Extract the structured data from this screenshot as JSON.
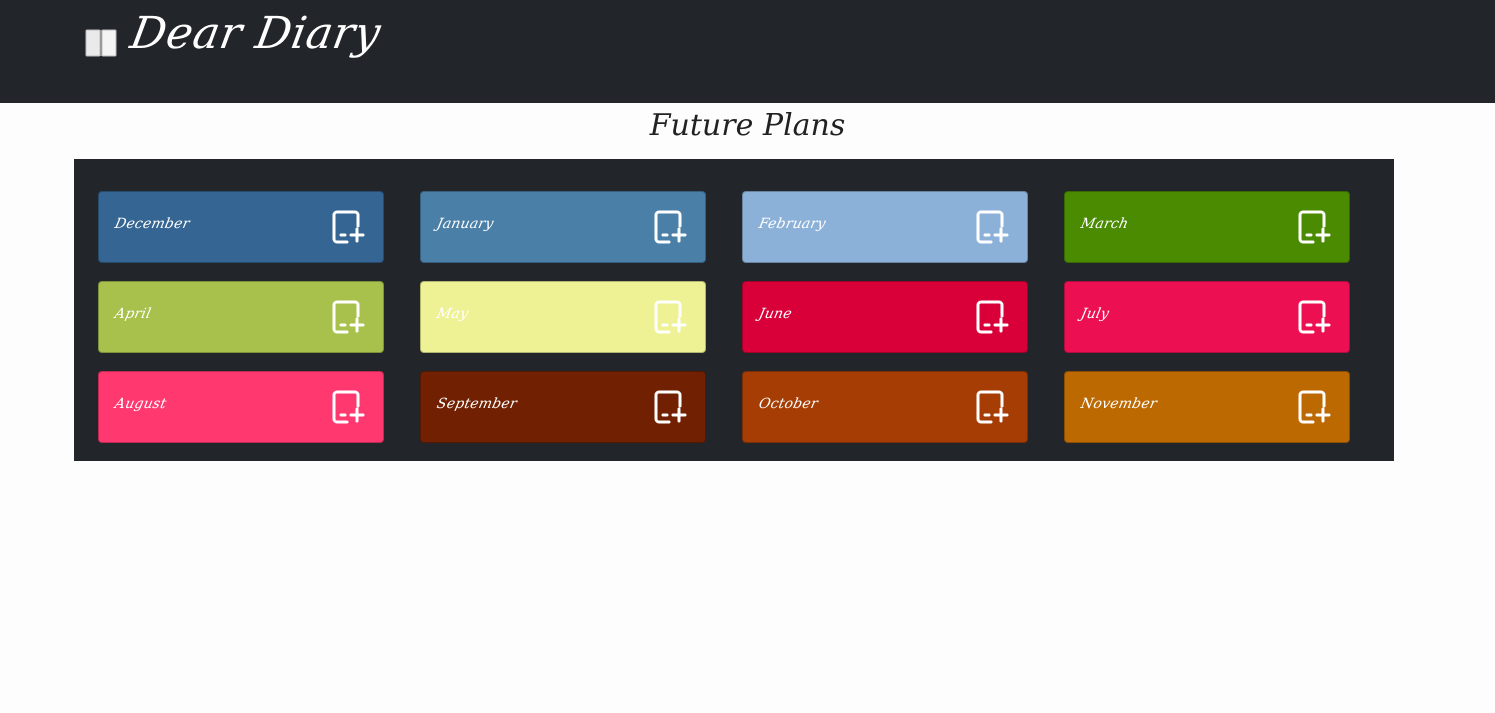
{
  "app": {
    "title": "Dear Diary",
    "brand_icon": "open-book-icon"
  },
  "page": {
    "title": "Future Plans"
  },
  "colors": {
    "navbar_bg": "#222529",
    "board_bg": "#222529",
    "page_bg": "#fdfdfd"
  },
  "months": [
    {
      "label": "December",
      "color": "#356592",
      "icon": "add-note-icon"
    },
    {
      "label": "January",
      "color": "#4a7fa8",
      "icon": "add-note-icon"
    },
    {
      "label": "February",
      "color": "#8cb1d9",
      "icon": "add-note-icon"
    },
    {
      "label": "March",
      "color": "#4a8b02",
      "icon": "add-note-icon"
    },
    {
      "label": "April",
      "color": "#a8c04c",
      "icon": "add-note-icon"
    },
    {
      "label": "May",
      "color": "#eef295",
      "icon": "add-note-icon"
    },
    {
      "label": "June",
      "color": "#d9003a",
      "icon": "add-note-icon"
    },
    {
      "label": "July",
      "color": "#ec1052",
      "icon": "add-note-icon"
    },
    {
      "label": "August",
      "color": "#ff3870",
      "icon": "add-note-icon"
    },
    {
      "label": "September",
      "color": "#712101",
      "icon": "add-note-icon"
    },
    {
      "label": "October",
      "color": "#a53d04",
      "icon": "add-note-icon"
    },
    {
      "label": "November",
      "color": "#bd6902",
      "icon": "add-note-icon"
    }
  ]
}
